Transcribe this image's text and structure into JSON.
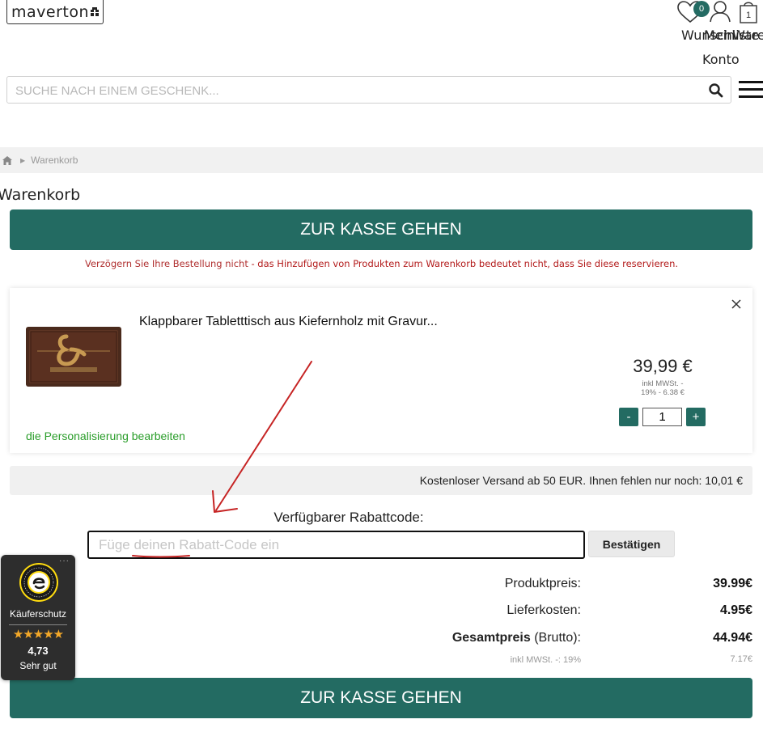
{
  "header": {
    "logo_text": "maverton",
    "wishlist_count": "0",
    "wishlist_label": "Wunschliste",
    "account_label_1": "Mein",
    "account_label_2": "Konto",
    "cart_label": "Waren",
    "cart_count": "1",
    "search_placeholder": "SUCHE NACH EINEM GESCHENK..."
  },
  "breadcrumb": {
    "current": "Warenkorb"
  },
  "page": {
    "title": "Warenkorb",
    "checkout_label": "ZUR KASSE GEHEN",
    "notice_part1": "Verzögern Sie Ihre Bestellung nicht",
    "notice_part2": " - das Hinzufügen von Produkten zum Warenkorb bedeutet nicht, dass Sie diese reservieren."
  },
  "product": {
    "name": "Klappbarer Tabletttisch aus Kiefernholz mit Gravur...",
    "price": "39,99 €",
    "tax_line1": "inkl MWSt. -",
    "tax_line2": "19% - 6.38 €",
    "quantity": "1",
    "minus_label": "-",
    "plus_label": "+",
    "edit_link": "die Personalisierung bearbeiten"
  },
  "shipping_notice": "Kostenloser Versand ab 50 EUR. Ihnen fehlen nur noch: 10,01 €",
  "discount": {
    "label": "Verfügbarer Rabattcode:",
    "placeholder": "Füge deinen Rabatt-Code ein",
    "button": "Bestätigen"
  },
  "summary": {
    "product_price_label": "Produktpreis:",
    "product_price": "39.99€",
    "shipping_label": "Lieferkosten:",
    "shipping": "4.95€",
    "total_label_bold": "Gesamtpreis",
    "total_label_rest": " (Brutto):",
    "total": "44.94€",
    "tax_label": "inkl MWSt. -: 19%",
    "tax": "7.17€"
  },
  "trusted_shops": {
    "label": "Käuferschutz",
    "stars": "★★★★★",
    "score": "4,73",
    "grade": "Sehr gut"
  },
  "colors": {
    "brand_green": "#236b62",
    "notice_red": "#b31b1b",
    "link_green": "#2a9d2a"
  }
}
